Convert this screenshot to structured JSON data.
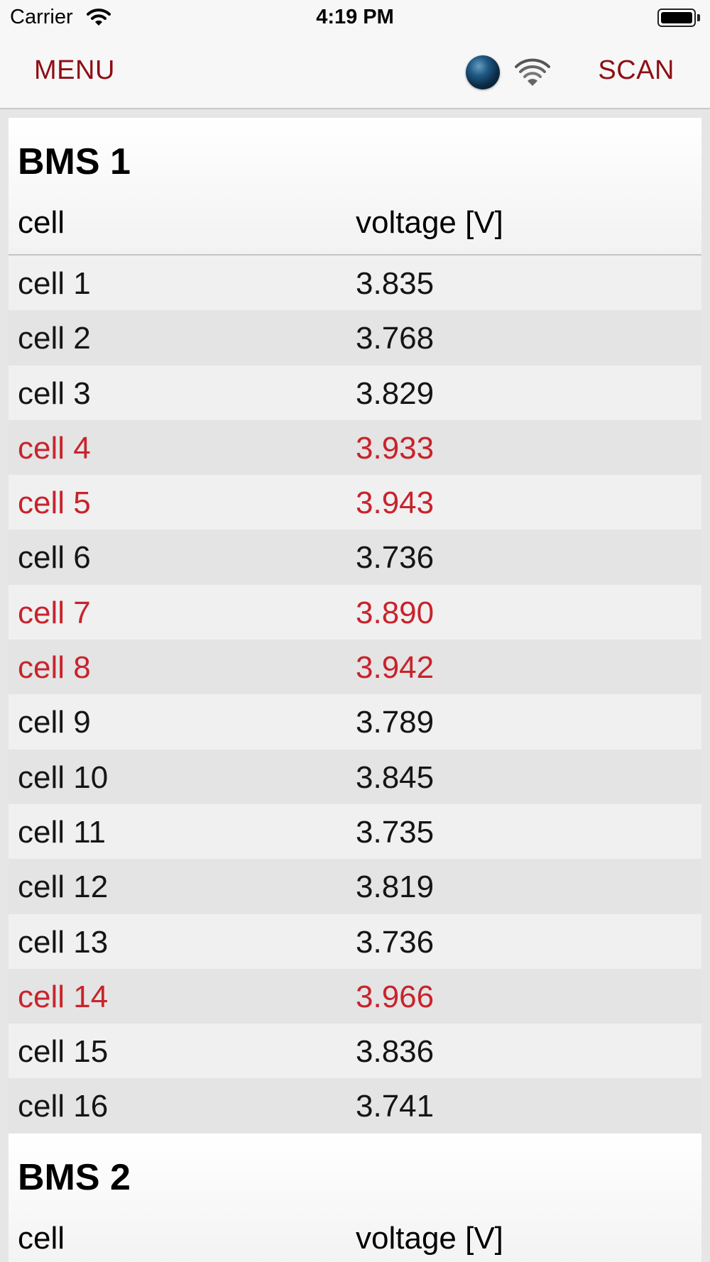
{
  "status_bar": {
    "carrier": "Carrier",
    "time": "4:19 PM"
  },
  "nav": {
    "menu_label": "MENU",
    "scan_label": "SCAN"
  },
  "colors": {
    "accent": "#8e0e14",
    "alert": "#c8232c"
  },
  "bms": [
    {
      "title": "BMS 1",
      "col_cell": "cell",
      "col_voltage": "voltage [V]",
      "rows": [
        {
          "cell": "cell 1",
          "voltage": "3.835",
          "alert": false
        },
        {
          "cell": "cell 2",
          "voltage": "3.768",
          "alert": false
        },
        {
          "cell": "cell 3",
          "voltage": "3.829",
          "alert": false
        },
        {
          "cell": "cell 4",
          "voltage": "3.933",
          "alert": true
        },
        {
          "cell": "cell 5",
          "voltage": "3.943",
          "alert": true
        },
        {
          "cell": "cell 6",
          "voltage": "3.736",
          "alert": false
        },
        {
          "cell": "cell 7",
          "voltage": "3.890",
          "alert": true
        },
        {
          "cell": "cell 8",
          "voltage": "3.942",
          "alert": true
        },
        {
          "cell": "cell 9",
          "voltage": "3.789",
          "alert": false
        },
        {
          "cell": "cell 10",
          "voltage": "3.845",
          "alert": false
        },
        {
          "cell": "cell 11",
          "voltage": "3.735",
          "alert": false
        },
        {
          "cell": "cell 12",
          "voltage": "3.819",
          "alert": false
        },
        {
          "cell": "cell 13",
          "voltage": "3.736",
          "alert": false
        },
        {
          "cell": "cell 14",
          "voltage": "3.966",
          "alert": true
        },
        {
          "cell": "cell 15",
          "voltage": "3.836",
          "alert": false
        },
        {
          "cell": "cell 16",
          "voltage": "3.741",
          "alert": false
        }
      ]
    },
    {
      "title": "BMS 2",
      "col_cell": "cell",
      "col_voltage": "voltage [V]",
      "rows": []
    }
  ]
}
